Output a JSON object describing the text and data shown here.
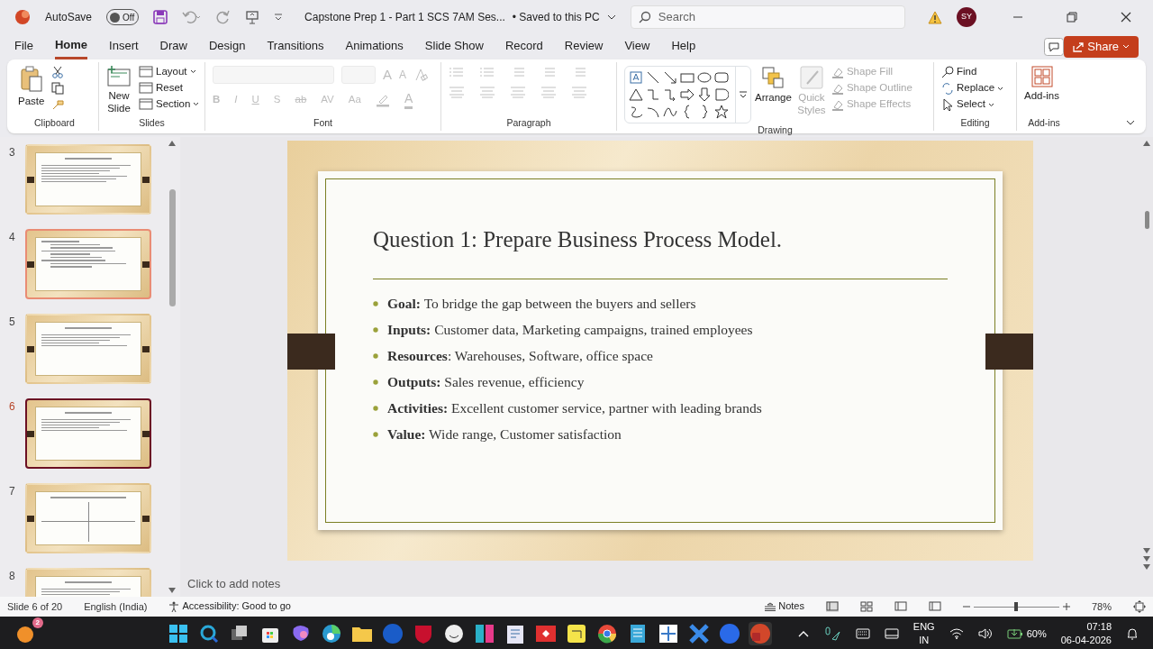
{
  "title_bar": {
    "autosave_label": "AutoSave",
    "autosave_toggle": {
      "label": "Off",
      "on": false
    },
    "document_title": "Capstone Prep 1 - Part 1 SCS 7AM Ses...",
    "save_status": "• Saved to this PC",
    "search_placeholder": "Search",
    "avatar_initials": "SY"
  },
  "menu_tabs": [
    {
      "label": "File",
      "selected": false
    },
    {
      "label": "Home",
      "selected": true
    },
    {
      "label": "Insert",
      "selected": false
    },
    {
      "label": "Draw",
      "selected": false
    },
    {
      "label": "Design",
      "selected": false
    },
    {
      "label": "Transitions",
      "selected": false
    },
    {
      "label": "Animations",
      "selected": false
    },
    {
      "label": "Slide Show",
      "selected": false
    },
    {
      "label": "Record",
      "selected": false
    },
    {
      "label": "Review",
      "selected": false
    },
    {
      "label": "View",
      "selected": false
    },
    {
      "label": "Help",
      "selected": false
    }
  ],
  "share_button": "Share",
  "ribbon": {
    "clipboard": {
      "label": "Clipboard",
      "paste": "Paste"
    },
    "slides": {
      "label": "Slides",
      "new_slide": "New Slide",
      "commands": [
        "Layout",
        "Reset",
        "Section"
      ]
    },
    "font": {
      "label": "Font",
      "disabled": true,
      "grow_glyphs": [
        "A",
        "A"
      ],
      "format_glyphs": [
        "B",
        "I",
        "U",
        "S",
        "ab",
        "AV",
        "Aa"
      ],
      "color_glyph": "A"
    },
    "paragraph": {
      "label": "Paragraph",
      "disabled": true
    },
    "drawing": {
      "label": "Drawing",
      "arrange": "Arrange",
      "quick_styles": {
        "label": "Quick Styles",
        "disabled": true
      },
      "shape_commands": [
        {
          "label": "Shape Fill",
          "disabled": true
        },
        {
          "label": "Shape Outline",
          "disabled": true
        },
        {
          "label": "Shape Effects",
          "disabled": true
        }
      ]
    },
    "editing": {
      "label": "Editing",
      "commands": [
        "Find",
        "Replace",
        "Select"
      ]
    },
    "addins": {
      "label": "Add-ins",
      "button": "Add-ins"
    }
  },
  "thumbnails": [
    {
      "number": "3",
      "selected": false,
      "hovered": false,
      "kind": "text"
    },
    {
      "number": "4",
      "selected": false,
      "hovered": true,
      "kind": "list"
    },
    {
      "number": "5",
      "selected": false,
      "hovered": false,
      "kind": "bullets"
    },
    {
      "number": "6",
      "selected": true,
      "hovered": false,
      "kind": "bullets"
    },
    {
      "number": "7",
      "selected": false,
      "hovered": false,
      "kind": "quadrant"
    },
    {
      "number": "8",
      "selected": false,
      "hovered": false,
      "kind": "text"
    }
  ],
  "slide": {
    "title": "Question 1: Prepare Business Process Model.",
    "bullets": [
      "**Goal:** To bridge the gap between the buyers and sellers",
      "**Inputs:** Customer data, Marketing campaigns, trained employees",
      "**Resources**: Warehouses, Software, office space",
      "**Outputs:** Sales revenue, efficiency",
      "**Activities:** Excellent customer service, partner with leading brands",
      "**Value:** Wide range, Customer satisfaction"
    ]
  },
  "notes_placeholder": "Click to add notes",
  "status_bar": {
    "slide_position": "Slide 6 of 20",
    "language": "English (India)",
    "accessibility": "Accessibility: Good to go",
    "notes_button": "Notes",
    "zoom": {
      "level": 0.5,
      "reading": "78%"
    }
  },
  "taskbar": {
    "notification_count": "2",
    "language": [
      "ENG",
      "IN"
    ],
    "battery": "60%",
    "time": "07:18",
    "date": "06-04-2026"
  }
}
